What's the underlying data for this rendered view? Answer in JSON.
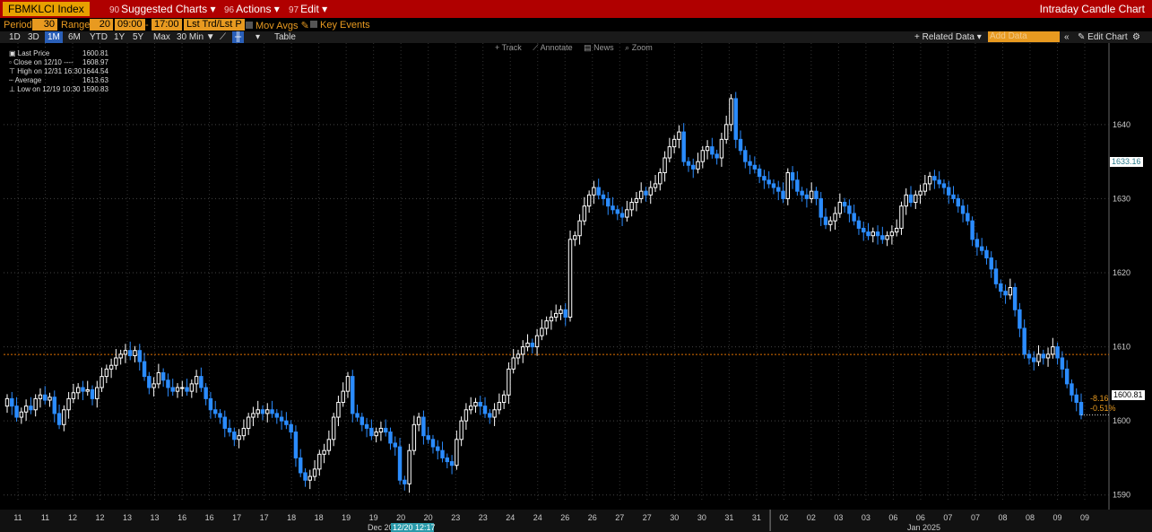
{
  "titlebar": {
    "ticker": "FBMKLCI Index",
    "menus": [
      {
        "num": "90",
        "label": "Suggested Charts ▾"
      },
      {
        "num": "96",
        "label": "Actions ▾"
      },
      {
        "num": "97",
        "label": "Edit ▾"
      }
    ],
    "title": "Intraday Candle Chart"
  },
  "controls": {
    "period_label": "Period",
    "period_value": "30",
    "range_label": "Range",
    "range_value": "20",
    "time_from": "09:00",
    "time_to": "17:00",
    "price_type": "Lst Trd/Lst P",
    "mov_avgs": "Mov Avgs",
    "key_events": "Key Events"
  },
  "timebar": {
    "items": [
      "1D",
      "3D",
      "1M",
      "6M",
      "YTD",
      "1Y",
      "5Y",
      "Max",
      "30 Min ▼",
      "Table"
    ],
    "selected": "1M",
    "related_data": "+ Related Data ▾",
    "add_data": "Add Data",
    "edit_chart": "✎ Edit Chart"
  },
  "tools": [
    "+ Track",
    "⟋ Annotate",
    "▤ News",
    "⌕ Zoom"
  ],
  "legend": [
    {
      "key": "Last Price",
      "value": "1600.81"
    },
    {
      "key": "Close on 12/10 ----",
      "value": "1608.97"
    },
    {
      "key": "High on 12/31 16:30",
      "value": "1644.54"
    },
    {
      "key": "Average",
      "value": "1613.63"
    },
    {
      "key": "Low on 12/19 10:30",
      "value": "1590.83"
    }
  ],
  "price_labels": {
    "average": "1633.16",
    "last": "1600.81",
    "change": "-8.16",
    "change_pct": "-0.51%"
  },
  "x_axis": {
    "dates": [
      "11",
      "11",
      "12",
      "12",
      "13",
      "13",
      "16",
      "16",
      "17",
      "17",
      "18",
      "18",
      "19",
      "19",
      "20",
      "20",
      "23",
      "23",
      "24",
      "24",
      "26",
      "26",
      "27",
      "27",
      "30",
      "30",
      "31",
      "31",
      "02",
      "02",
      "03",
      "03",
      "06",
      "06",
      "07",
      "07",
      "08",
      "08",
      "09",
      "09"
    ],
    "month_left": "Dec 2024",
    "month_right": "Jan 2025",
    "cursor_label": "12/20 12:17"
  },
  "chart_data": {
    "type": "candlestick",
    "ylim": [
      1589,
      1651
    ],
    "yticks": [
      1590,
      1600,
      1610,
      1620,
      1630,
      1640
    ],
    "reference_close": 1608.97,
    "colors": {
      "up": "#ffffff",
      "down": "#2b8cff",
      "ref_line": "#e07000",
      "background": "#000000"
    },
    "closes": [
      1603.0,
      1602.0,
      1600.5,
      1601.2,
      1602.0,
      1601.5,
      1603.0,
      1603.5,
      1602.8,
      1603.2,
      1601.0,
      1599.5,
      1601.5,
      1603.0,
      1603.8,
      1604.5,
      1604.0,
      1604.2,
      1603.0,
      1604.5,
      1606.0,
      1607.0,
      1607.5,
      1608.5,
      1609.0,
      1609.5,
      1608.8,
      1609.5,
      1608.0,
      1606.0,
      1604.5,
      1605.0,
      1606.5,
      1605.5,
      1604.5,
      1604.0,
      1604.5,
      1604.5,
      1604.0,
      1605.0,
      1606.0,
      1604.5,
      1603.0,
      1601.5,
      1601.0,
      1600.5,
      1599.0,
      1598.5,
      1597.5,
      1598.0,
      1599.0,
      1600.5,
      1601.0,
      1601.5,
      1601.0,
      1601.5,
      1601.0,
      1600.5,
      1600.0,
      1599.5,
      1598.5,
      1595.0,
      1593.0,
      1592.0,
      1592.5,
      1593.5,
      1595.5,
      1596.0,
      1597.5,
      1600.5,
      1602.5,
      1604.0,
      1606.0,
      1601.0,
      1600.5,
      1599.5,
      1599.0,
      1598.0,
      1598.5,
      1599.0,
      1598.5,
      1597.0,
      1596.5,
      1592.0,
      1591.5,
      1596.0,
      1599.5,
      1600.5,
      1598.0,
      1597.5,
      1596.5,
      1596.0,
      1595.0,
      1594.5,
      1594.0,
      1597.5,
      1600.0,
      1601.5,
      1602.0,
      1602.5,
      1602.0,
      1601.0,
      1600.5,
      1601.5,
      1602.5,
      1603.5,
      1607.0,
      1608.5,
      1609.0,
      1610.0,
      1610.5,
      1610.0,
      1611.5,
      1612.5,
      1613.5,
      1614.0,
      1614.5,
      1615.0,
      1614.0,
      1624.5,
      1625.0,
      1627.0,
      1629.0,
      1630.5,
      1631.5,
      1630.5,
      1630.0,
      1629.0,
      1628.5,
      1628.0,
      1627.5,
      1628.5,
      1629.5,
      1630.0,
      1631.0,
      1630.5,
      1631.5,
      1632.0,
      1633.5,
      1635.5,
      1637.0,
      1638.0,
      1639.0,
      1635.0,
      1634.5,
      1634.0,
      1635.0,
      1636.5,
      1637.0,
      1636.0,
      1635.5,
      1638.0,
      1640.0,
      1643.5,
      1638.0,
      1636.5,
      1635.0,
      1634.5,
      1634.0,
      1633.0,
      1632.5,
      1632.0,
      1631.5,
      1631.0,
      1630.0,
      1633.5,
      1632.5,
      1631.0,
      1630.5,
      1630.0,
      1631.0,
      1630.0,
      1627.5,
      1626.5,
      1627.0,
      1628.0,
      1629.5,
      1629.0,
      1628.0,
      1627.0,
      1626.0,
      1625.5,
      1625.0,
      1625.5,
      1625.0,
      1624.5,
      1625.0,
      1625.5,
      1626.0,
      1629.0,
      1630.5,
      1629.5,
      1630.5,
      1631.0,
      1632.0,
      1633.0,
      1632.5,
      1632.0,
      1631.5,
      1630.5,
      1630.0,
      1629.0,
      1628.0,
      1627.0,
      1624.5,
      1623.5,
      1623.0,
      1622.0,
      1620.5,
      1618.5,
      1617.5,
      1617.0,
      1618.0,
      1615.0,
      1612.5,
      1609.0,
      1608.5,
      1608.0,
      1609.0,
      1608.5,
      1609.0,
      1610.0,
      1608.5,
      1607.0,
      1605.0,
      1603.5,
      1602.5,
      1600.81
    ]
  }
}
